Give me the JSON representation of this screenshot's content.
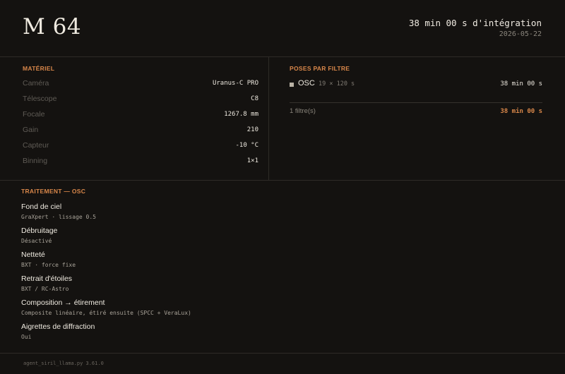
{
  "header": {
    "title": "M 64",
    "integration": "38 min 00 s d'intégration",
    "date": "2026-05-22"
  },
  "materiel": {
    "title": "MATÉRIEL",
    "rows": [
      {
        "label": "Caméra",
        "value": "Uranus-C PRO"
      },
      {
        "label": "Télescope",
        "value": "C8"
      },
      {
        "label": "Focale",
        "value": "1267.8 mm"
      },
      {
        "label": "Gain",
        "value": "210"
      },
      {
        "label": "Capteur",
        "value": "-10 °C"
      },
      {
        "label": "Binning",
        "value": "1×1"
      }
    ]
  },
  "poses": {
    "title": "POSES PAR FILTRE",
    "filters": [
      {
        "name": "OSC",
        "detail": "19 × 120 s",
        "total": "38 min 00 s"
      }
    ],
    "summary_label": "1 filtre(s)",
    "summary_total": "38 min 00 s"
  },
  "traitement": {
    "title": "TRAITEMENT — OSC",
    "steps": [
      {
        "name": "Fond de ciel",
        "detail": "GraXpert · lissage 0.5"
      },
      {
        "name": "Débruitage",
        "detail": "Désactivé"
      },
      {
        "name": "Netteté",
        "detail": "BXT · force fixe"
      },
      {
        "name": "Retrait d'étoiles",
        "detail": "BXT / RC-Astro"
      },
      {
        "name": "Composition → étirement",
        "detail": "Composite linéaire, étiré ensuite (SPCC + VeraLux)"
      },
      {
        "name": "Aigrettes de diffraction",
        "detail": "Oui"
      }
    ]
  },
  "footer": {
    "text": "agent_siril_llama.py 3.61.0"
  },
  "colors": {
    "background": "#141210",
    "accent": "#d9874a",
    "text": "#efeae0",
    "muted": "#5f5b55"
  }
}
